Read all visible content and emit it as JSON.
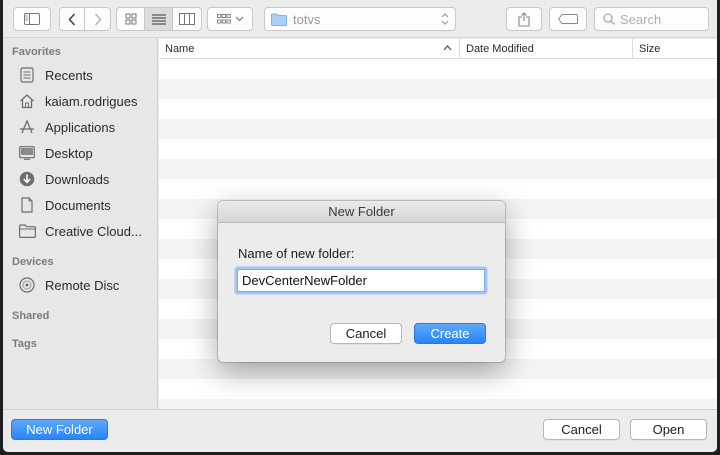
{
  "toolbar": {
    "path_folder": "totvs",
    "search_placeholder": "Search"
  },
  "sidebar": {
    "favorites_header": "Favorites",
    "favorites": [
      {
        "label": "Recents",
        "icon": "recents-icon"
      },
      {
        "label": "kaiam.rodrigues",
        "icon": "home-icon"
      },
      {
        "label": "Applications",
        "icon": "applications-icon"
      },
      {
        "label": "Desktop",
        "icon": "desktop-icon"
      },
      {
        "label": "Downloads",
        "icon": "downloads-icon"
      },
      {
        "label": "Documents",
        "icon": "documents-icon"
      },
      {
        "label": "Creative Cloud...",
        "icon": "folder-icon"
      }
    ],
    "devices_header": "Devices",
    "devices": [
      {
        "label": "Remote Disc",
        "icon": "disc-icon"
      }
    ],
    "shared_header": "Shared",
    "tags_header": "Tags"
  },
  "filelist": {
    "columns": [
      "Name",
      "Date Modified",
      "Size"
    ],
    "sort_column": "Name",
    "sort_direction": "ascending",
    "rows": []
  },
  "dialog": {
    "title": "New Folder",
    "label": "Name of new folder:",
    "input_value": "DevCenterNewFolder",
    "cancel_label": "Cancel",
    "create_label": "Create"
  },
  "bottombar": {
    "new_folder_label": "New Folder",
    "cancel_label": "Cancel",
    "open_label": "Open"
  },
  "colors": {
    "accent": "#2a84f6",
    "window_bg": "#ececec",
    "row_alt": "#f4f4f5"
  }
}
